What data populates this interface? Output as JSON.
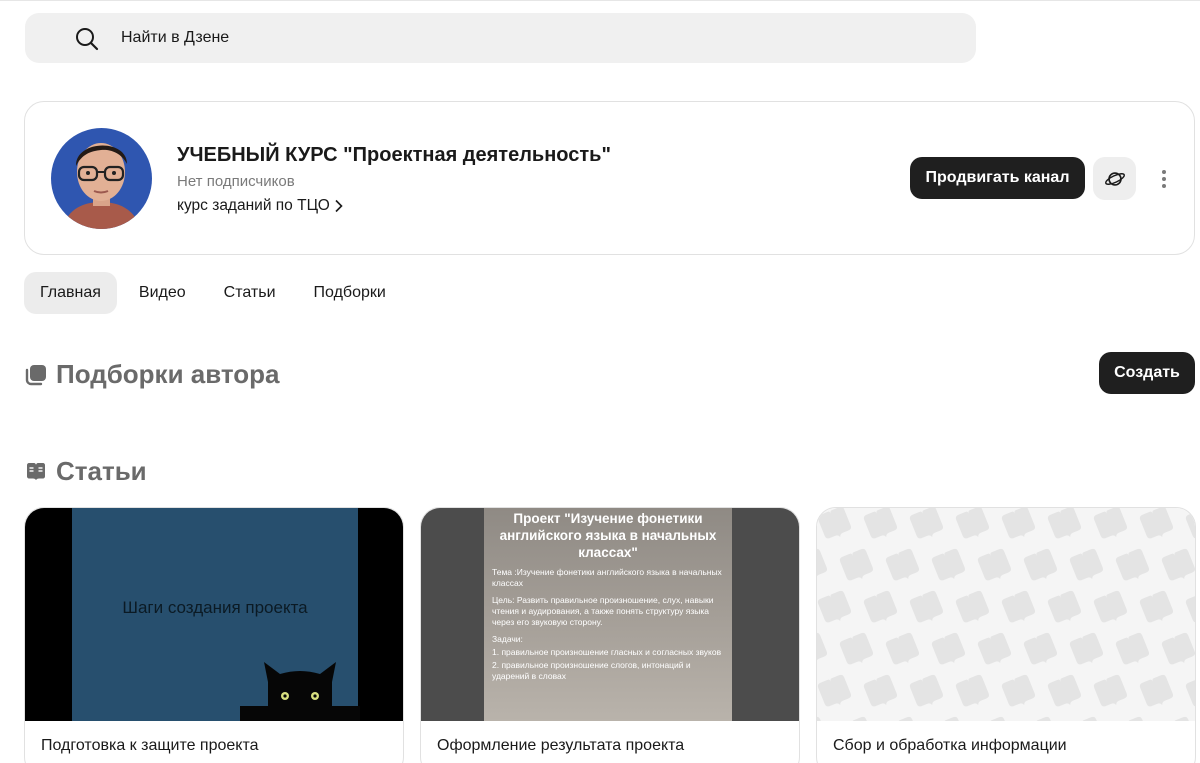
{
  "search": {
    "placeholder": "Найти в Дзене"
  },
  "channel": {
    "title": "УЧЕБНЫЙ КУРС \"Проектная деятельность\"",
    "subscribers": "Нет подписчиков",
    "description": "курс заданий по ТЦО",
    "promote_label": "Продвигать канал"
  },
  "tabs": [
    {
      "label": "Главная"
    },
    {
      "label": "Видео"
    },
    {
      "label": "Статьи"
    },
    {
      "label": "Подборки"
    }
  ],
  "collections": {
    "title": "Подборки автора",
    "create_label": "Создать"
  },
  "articles_section": {
    "title": "Статьи"
  },
  "articles": [
    {
      "title": "Подготовка к защите проекта",
      "thumb_text": "Шаги создания проекта"
    },
    {
      "title": "Оформление результата проекта",
      "thumb_heading": "Проект \"Изучение фонетики английского языка в начальных классах\"",
      "thumb_theme": "Тема :Изучение фонетики английского языка в начальных классах",
      "thumb_goal": "Цель: Развить правильное произношение, слух, навыки чтения и аудирования, а также понять структуру языка через его звуковую сторону.",
      "thumb_tasks_label": "Задачи:",
      "thumb_task1": "1. правильное произношение гласных и согласных звуков",
      "thumb_task2": "2. правильное произношение слогов, интонаций и ударений в словах"
    },
    {
      "title": "Сбор и обработка информации"
    }
  ],
  "colors": {
    "primary_button": "#1f1f1f",
    "surface": "#f0f0f0",
    "section_title": "#6a6a6a"
  }
}
